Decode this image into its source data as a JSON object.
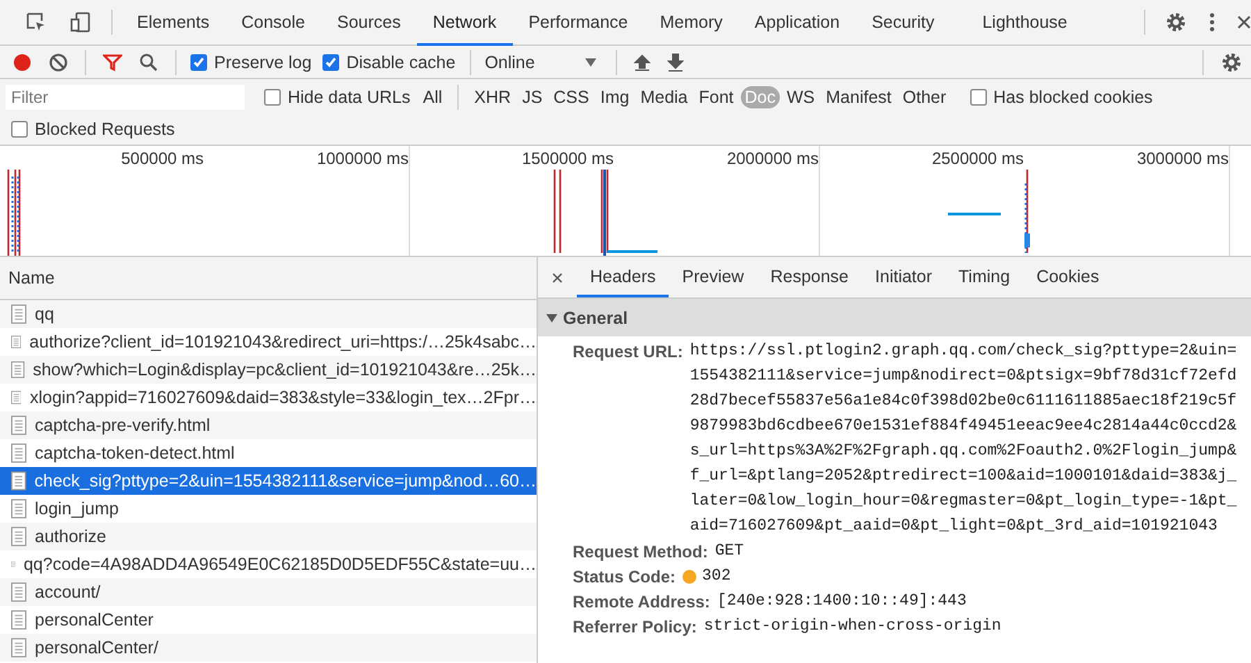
{
  "panel_tabs": [
    {
      "label": "Elements",
      "selected": false
    },
    {
      "label": "Console",
      "selected": false
    },
    {
      "label": "Sources",
      "selected": false
    },
    {
      "label": "Network",
      "selected": true
    },
    {
      "label": "Performance",
      "selected": false
    },
    {
      "label": "Memory",
      "selected": false
    },
    {
      "label": "Application",
      "selected": false
    },
    {
      "label": "Security",
      "selected": false
    },
    {
      "label": "Lighthouse",
      "selected": false
    }
  ],
  "toolbar": {
    "recording": true,
    "preserve_log": {
      "label": "Preserve log",
      "checked": true
    },
    "disable_cache": {
      "label": "Disable cache",
      "checked": true
    },
    "throttling": "Online"
  },
  "filter_bar": {
    "placeholder": "Filter",
    "hide_data_urls": {
      "label": "Hide data URLs",
      "checked": false
    },
    "types": [
      {
        "label": "All",
        "selected": false
      },
      {
        "label": "XHR",
        "selected": false
      },
      {
        "label": "JS",
        "selected": false
      },
      {
        "label": "CSS",
        "selected": false
      },
      {
        "label": "Img",
        "selected": false
      },
      {
        "label": "Media",
        "selected": false
      },
      {
        "label": "Font",
        "selected": false
      },
      {
        "label": "Doc",
        "selected": true
      },
      {
        "label": "WS",
        "selected": false
      },
      {
        "label": "Manifest",
        "selected": false
      },
      {
        "label": "Other",
        "selected": false
      }
    ],
    "has_blocked_cookies": {
      "label": "Has blocked cookies",
      "checked": false
    },
    "blocked_requests": {
      "label": "Blocked Requests",
      "checked": false
    }
  },
  "timeline": {
    "ticks": [
      "500000 ms",
      "1000000 ms",
      "1500000 ms",
      "2000000 ms",
      "2500000 ms",
      "3000000 ms"
    ]
  },
  "requests": {
    "column": "Name",
    "rows": [
      {
        "name": "qq",
        "selected": false
      },
      {
        "name": "authorize?client_id=101921043&redirect_uri=https:/…25k4sabc…",
        "selected": false
      },
      {
        "name": "show?which=Login&display=pc&client_id=101921043&re…25k…",
        "selected": false
      },
      {
        "name": "xlogin?appid=716027609&daid=383&style=33&login_tex…2Fpr…",
        "selected": false
      },
      {
        "name": "captcha-pre-verify.html",
        "selected": false
      },
      {
        "name": "captcha-token-detect.html",
        "selected": false
      },
      {
        "name": "check_sig?pttype=2&uin=1554382111&service=jump&nod…60…",
        "selected": true
      },
      {
        "name": "login_jump",
        "selected": false
      },
      {
        "name": "authorize",
        "selected": false
      },
      {
        "name": "qq?code=4A98ADD4A96549E0C62185D0D5EDF55C&state=uu…",
        "selected": false
      },
      {
        "name": "account/",
        "selected": false
      },
      {
        "name": "personalCenter",
        "selected": false
      },
      {
        "name": "personalCenter/",
        "selected": false
      }
    ]
  },
  "details": {
    "tabs": [
      {
        "label": "Headers",
        "selected": true
      },
      {
        "label": "Preview",
        "selected": false
      },
      {
        "label": "Response",
        "selected": false
      },
      {
        "label": "Initiator",
        "selected": false
      },
      {
        "label": "Timing",
        "selected": false
      },
      {
        "label": "Cookies",
        "selected": false
      }
    ],
    "section": {
      "title": "General",
      "expanded": true,
      "fields": [
        {
          "label": "Request URL:",
          "value": "https://ssl.ptlogin2.graph.qq.com/check_sig?pttype=2&uin=1554382111&service=jump&nodirect=0&ptsigx=9bf78d31cf72efd28d7becef55837e56a1e84c0f398d02be0c6111611885aec18f219c5f9879983bd6cdbee670e1531ef884f49451eeac9ee4c2814a44c0ccd2&s_url=https%3A%2F%2Fgraph.qq.com%2Foauth2.0%2Flogin_jump&f_url=&ptlang=2052&ptredirect=100&aid=1000101&daid=383&j_later=0&low_login_hour=0&regmaster=0&pt_login_type=-1&pt_aid=716027609&pt_aaid=0&pt_light=0&pt_3rd_aid=101921043",
          "kind": "text"
        },
        {
          "label": "Request Method:",
          "value": "GET",
          "kind": "text"
        },
        {
          "label": "Status Code:",
          "value": "302",
          "kind": "status"
        },
        {
          "label": "Remote Address:",
          "value": "[240e:928:1400:10::49]:443",
          "kind": "text"
        },
        {
          "label": "Referrer Policy:",
          "value": "strict-origin-when-cross-origin",
          "kind": "text"
        }
      ]
    }
  }
}
